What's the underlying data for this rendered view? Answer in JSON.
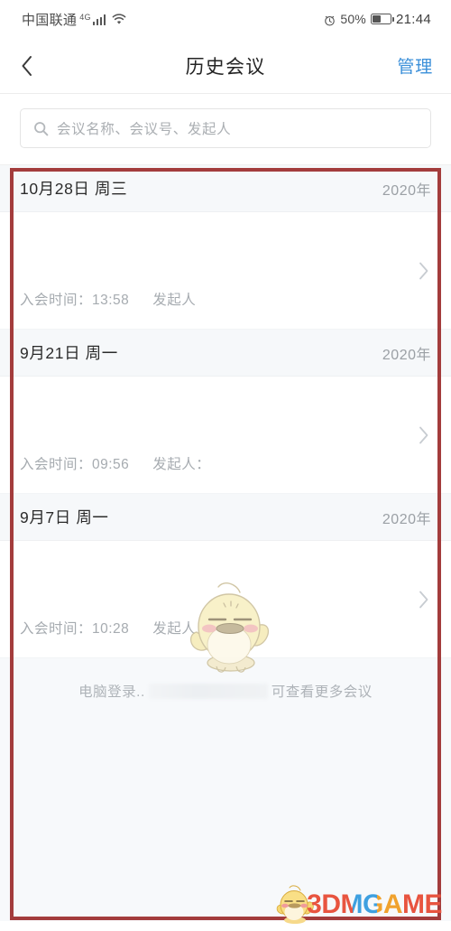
{
  "status_bar": {
    "carrier": "中国联通",
    "network_type": "4G",
    "wifi_icon": "wifi-icon",
    "signal_icon": "signal-bars-icon",
    "alarm_icon": "alarm-clock-icon",
    "battery_percent": "50%",
    "battery_level": 50,
    "clock": "21:44"
  },
  "nav": {
    "back_icon": "chevron-left-icon",
    "title": "历史会议",
    "action_label": "管理",
    "action_color": "#3a8fd9"
  },
  "search": {
    "icon": "search-icon",
    "placeholder": "会议名称、会议号、发起人",
    "value": ""
  },
  "list": {
    "groups": [
      {
        "date_label": "10月28日 周三",
        "year": "2020年",
        "meetings": [
          {
            "title": "",
            "join_time_label": "入会时间：13:58",
            "host_label": "发起人",
            "chevron_icon": "chevron-right-icon"
          }
        ]
      },
      {
        "date_label": "9月21日 周一",
        "year": "2020年",
        "meetings": [
          {
            "title": "",
            "join_time_label": "入会时间：09:56",
            "host_label": "发起人：",
            "chevron_icon": "chevron-right-icon"
          }
        ]
      },
      {
        "date_label": "9月7日 周一",
        "year": "2020年",
        "meetings": [
          {
            "title": "",
            "join_time_label": "入会时间：10:28",
            "host_label": "发起人",
            "chevron_icon": "chevron-right-icon"
          }
        ]
      }
    ]
  },
  "footer": {
    "text_before": "电脑登录..",
    "text_after": "可查看更多会议"
  },
  "watermark": {
    "text": "3DMGAME",
    "mascot_icon": "chick-mascot-icon"
  },
  "annotation": {
    "box_color": "#a33c3c"
  },
  "overlay": {
    "mascot_icon": "chick-mascot-icon"
  }
}
